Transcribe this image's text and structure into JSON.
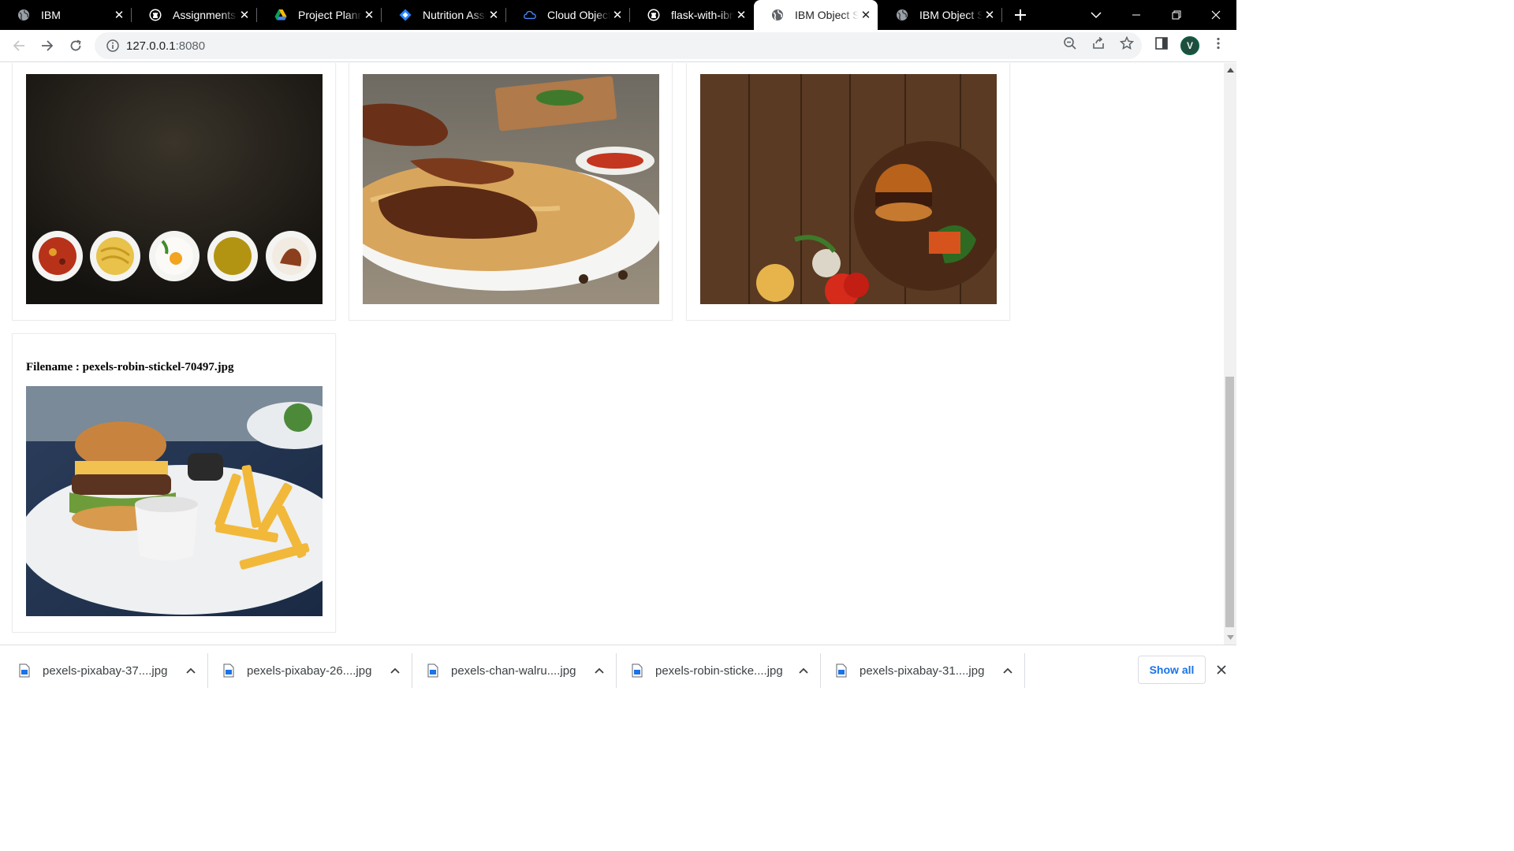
{
  "browser": {
    "tabs": [
      {
        "title": "IBM",
        "icon": "globe-icon",
        "active": false
      },
      {
        "title": "Assignments-C",
        "icon": "github-icon",
        "active": false
      },
      {
        "title": "Project Plannin",
        "icon": "google-drive-icon",
        "active": false
      },
      {
        "title": "Nutrition Assis",
        "icon": "jira-icon",
        "active": false
      },
      {
        "title": "Cloud Object S",
        "icon": "ibm-cloud-icon",
        "active": false
      },
      {
        "title": "flask-with-ibm",
        "icon": "github-icon",
        "active": false
      },
      {
        "title": "IBM Object Sto",
        "icon": "globe-icon",
        "active": true
      },
      {
        "title": "IBM Object Sto",
        "icon": "globe-icon",
        "active": false
      }
    ],
    "url_host": "127.0.0.1",
    "url_port": ":8080",
    "profile_initial": "V"
  },
  "page": {
    "cards": [
      {
        "filename_label": "",
        "image": "food-plates-dark-photo"
      },
      {
        "filename_label": "",
        "image": "biryani-plate-photo"
      },
      {
        "filename_label": "",
        "image": "burger-board-photo"
      },
      {
        "filename_label": "Filename : pexels-robin-stickel-70497.jpg",
        "image": "burger-fries-photo"
      }
    ]
  },
  "downloads": {
    "items": [
      {
        "name": "pexels-pixabay-37....jpg"
      },
      {
        "name": "pexels-pixabay-26....jpg"
      },
      {
        "name": "pexels-chan-walru....jpg"
      },
      {
        "name": "pexels-robin-sticke....jpg"
      },
      {
        "name": "pexels-pixabay-31....jpg"
      }
    ],
    "show_all_label": "Show all"
  },
  "colors": {
    "tabstrip_bg": "#000000",
    "show_all_text": "#1a73e8",
    "omnibox_bg": "#f1f3f4"
  }
}
